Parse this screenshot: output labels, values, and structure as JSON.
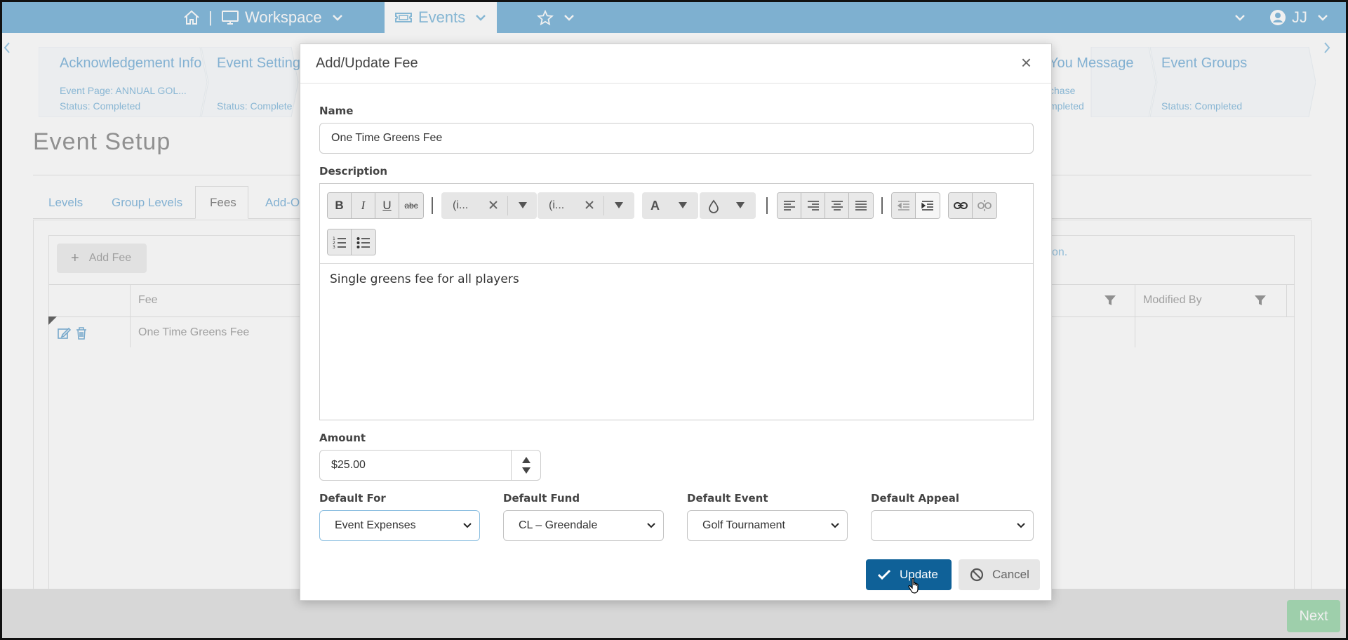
{
  "topbar": {
    "workspace_label": "Workspace",
    "events_label": "Events",
    "user_initials": "JJ",
    "separator": "|"
  },
  "wizard": {
    "steps": [
      {
        "title": "Acknowledgement Info",
        "line1": "Event Page: ANNUAL GOL...",
        "line2": "Status: Completed"
      },
      {
        "title": "Event Settings",
        "line1": "",
        "line2": "Status: Complete"
      },
      {
        "title": "You Message",
        "line1": "chase",
        "line2": "mpleted"
      },
      {
        "title": "Event Groups",
        "line1": "",
        "line2": "Status: Completed"
      }
    ]
  },
  "page": {
    "title": "Event Setup",
    "tabs": [
      "Levels",
      "Group Levels",
      "Fees",
      "Add-O"
    ],
    "add_fee_label": "Add Fee",
    "hint_fragment": "on.",
    "columns": {
      "fee": "Fee",
      "modified_by": "Modified By"
    },
    "rows": [
      {
        "fee": "One Time Greens Fee"
      }
    ],
    "next_label": "Next"
  },
  "modal": {
    "title": "Add/Update Fee",
    "close_glyph": "×",
    "name_label": "Name",
    "name_value": "One Time Greens Fee",
    "description_label": "Description",
    "toolbar": {
      "bold": "B",
      "italic": "I",
      "underline": "U",
      "strike": "abc",
      "font_name": "(i...",
      "font_size": "(i...",
      "font_color": "A"
    },
    "description_value": "Single greens fee for all players",
    "amount_label": "Amount",
    "amount_value": "$25.00",
    "default_for_label": "Default For",
    "default_for_value": "Event Expenses",
    "default_fund_label": "Default Fund",
    "default_fund_value": "CL – Greendale",
    "default_event_label": "Default Event",
    "default_event_value": "Golf Tournament",
    "default_appeal_label": "Default Appeal",
    "default_appeal_value": "",
    "update_label": "Update",
    "cancel_label": "Cancel"
  },
  "colors": {
    "topbar": "#86bcdd",
    "primary": "#0f6198",
    "link": "#8cbde0",
    "next": "#a8dcb6"
  }
}
